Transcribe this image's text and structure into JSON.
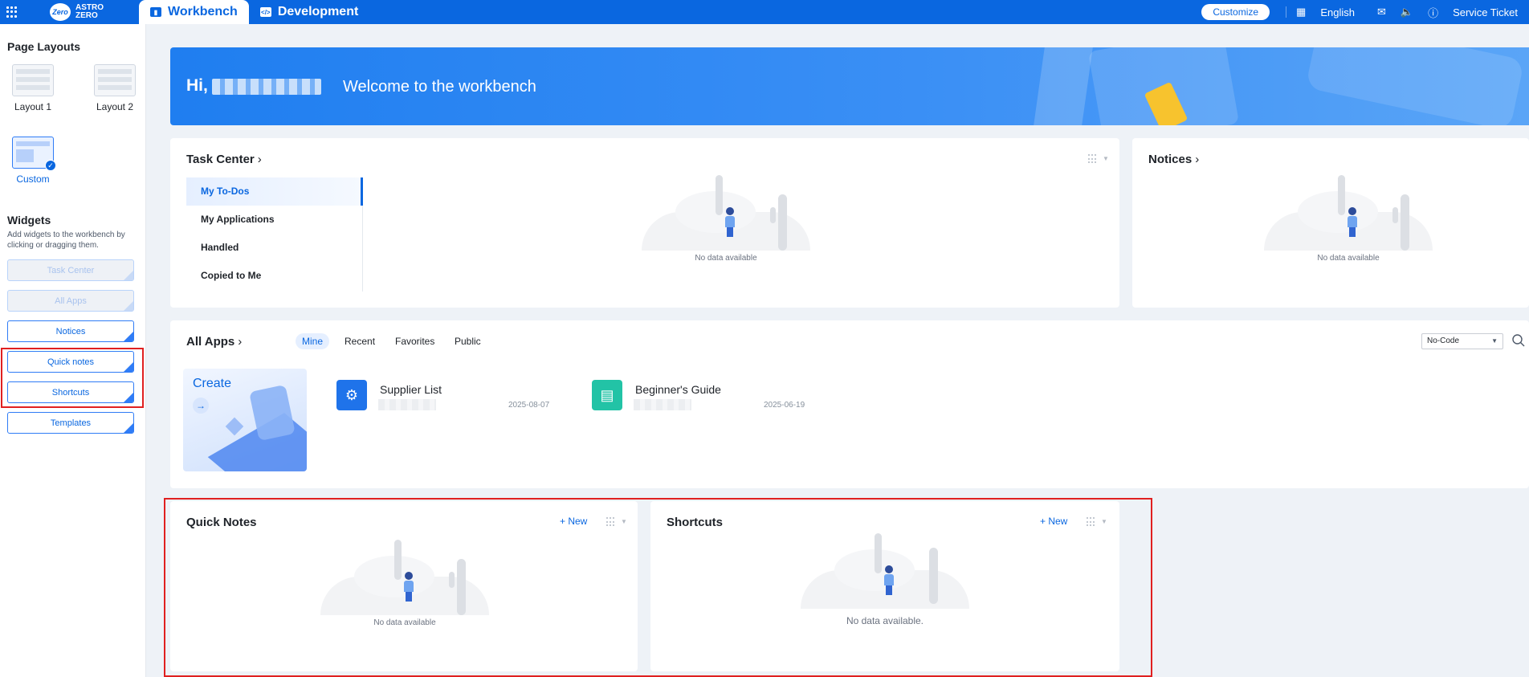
{
  "topbar": {
    "logo_line1": "ASTRO",
    "logo_line2": "ZERO",
    "logo_mark": "Zero",
    "tabs": [
      {
        "label": "Workbench",
        "icon": "chart-icon"
      },
      {
        "label": "Development",
        "icon": "code-icon"
      }
    ],
    "customize_label": "Customize",
    "language": "English",
    "service_ticket": "Service Ticket"
  },
  "sidebar": {
    "page_layouts_title": "Page Layouts",
    "layouts": [
      {
        "label": "Layout 1"
      },
      {
        "label": "Layout 2"
      },
      {
        "label": "Custom",
        "selected": true
      }
    ],
    "widgets_title": "Widgets",
    "widgets_desc": "Add widgets to the workbench by clicking or dragging them.",
    "widgets": [
      {
        "label": "Task Center",
        "disabled": true
      },
      {
        "label": "All Apps",
        "disabled": true
      },
      {
        "label": "Notices",
        "disabled": false
      },
      {
        "label": "Quick notes",
        "disabled": false
      },
      {
        "label": "Shortcuts",
        "disabled": false
      },
      {
        "label": "Templates",
        "disabled": false
      }
    ]
  },
  "banner": {
    "greeting": "Hi,",
    "welcome": "Welcome to the workbench"
  },
  "task_center": {
    "title": "Task Center",
    "tabs": [
      "My To-Dos",
      "My Applications",
      "Handled",
      "Copied to Me"
    ],
    "active_tab": "My To-Dos",
    "empty_text": "No data available"
  },
  "notices": {
    "title": "Notices",
    "empty_text": "No data available"
  },
  "all_apps": {
    "title": "All Apps",
    "filters": [
      "Mine",
      "Recent",
      "Favorites",
      "Public"
    ],
    "active_filter": "Mine",
    "select_value": "No-Code",
    "create_label": "Create",
    "apps": [
      {
        "name": "Supplier List",
        "date": "2025-08-07",
        "color": "#1f73ea"
      },
      {
        "name": "Beginner's Guide",
        "date": "2025-06-19",
        "color": "#22c3a6"
      }
    ]
  },
  "quick_notes": {
    "title": "Quick Notes",
    "new_label": "+ New",
    "empty_text": "No data available"
  },
  "shortcuts": {
    "title": "Shortcuts",
    "new_label": "+ New",
    "empty_text": "No data available."
  },
  "colors": {
    "brand": "#0a67e0",
    "highlight_border": "#e02020"
  }
}
